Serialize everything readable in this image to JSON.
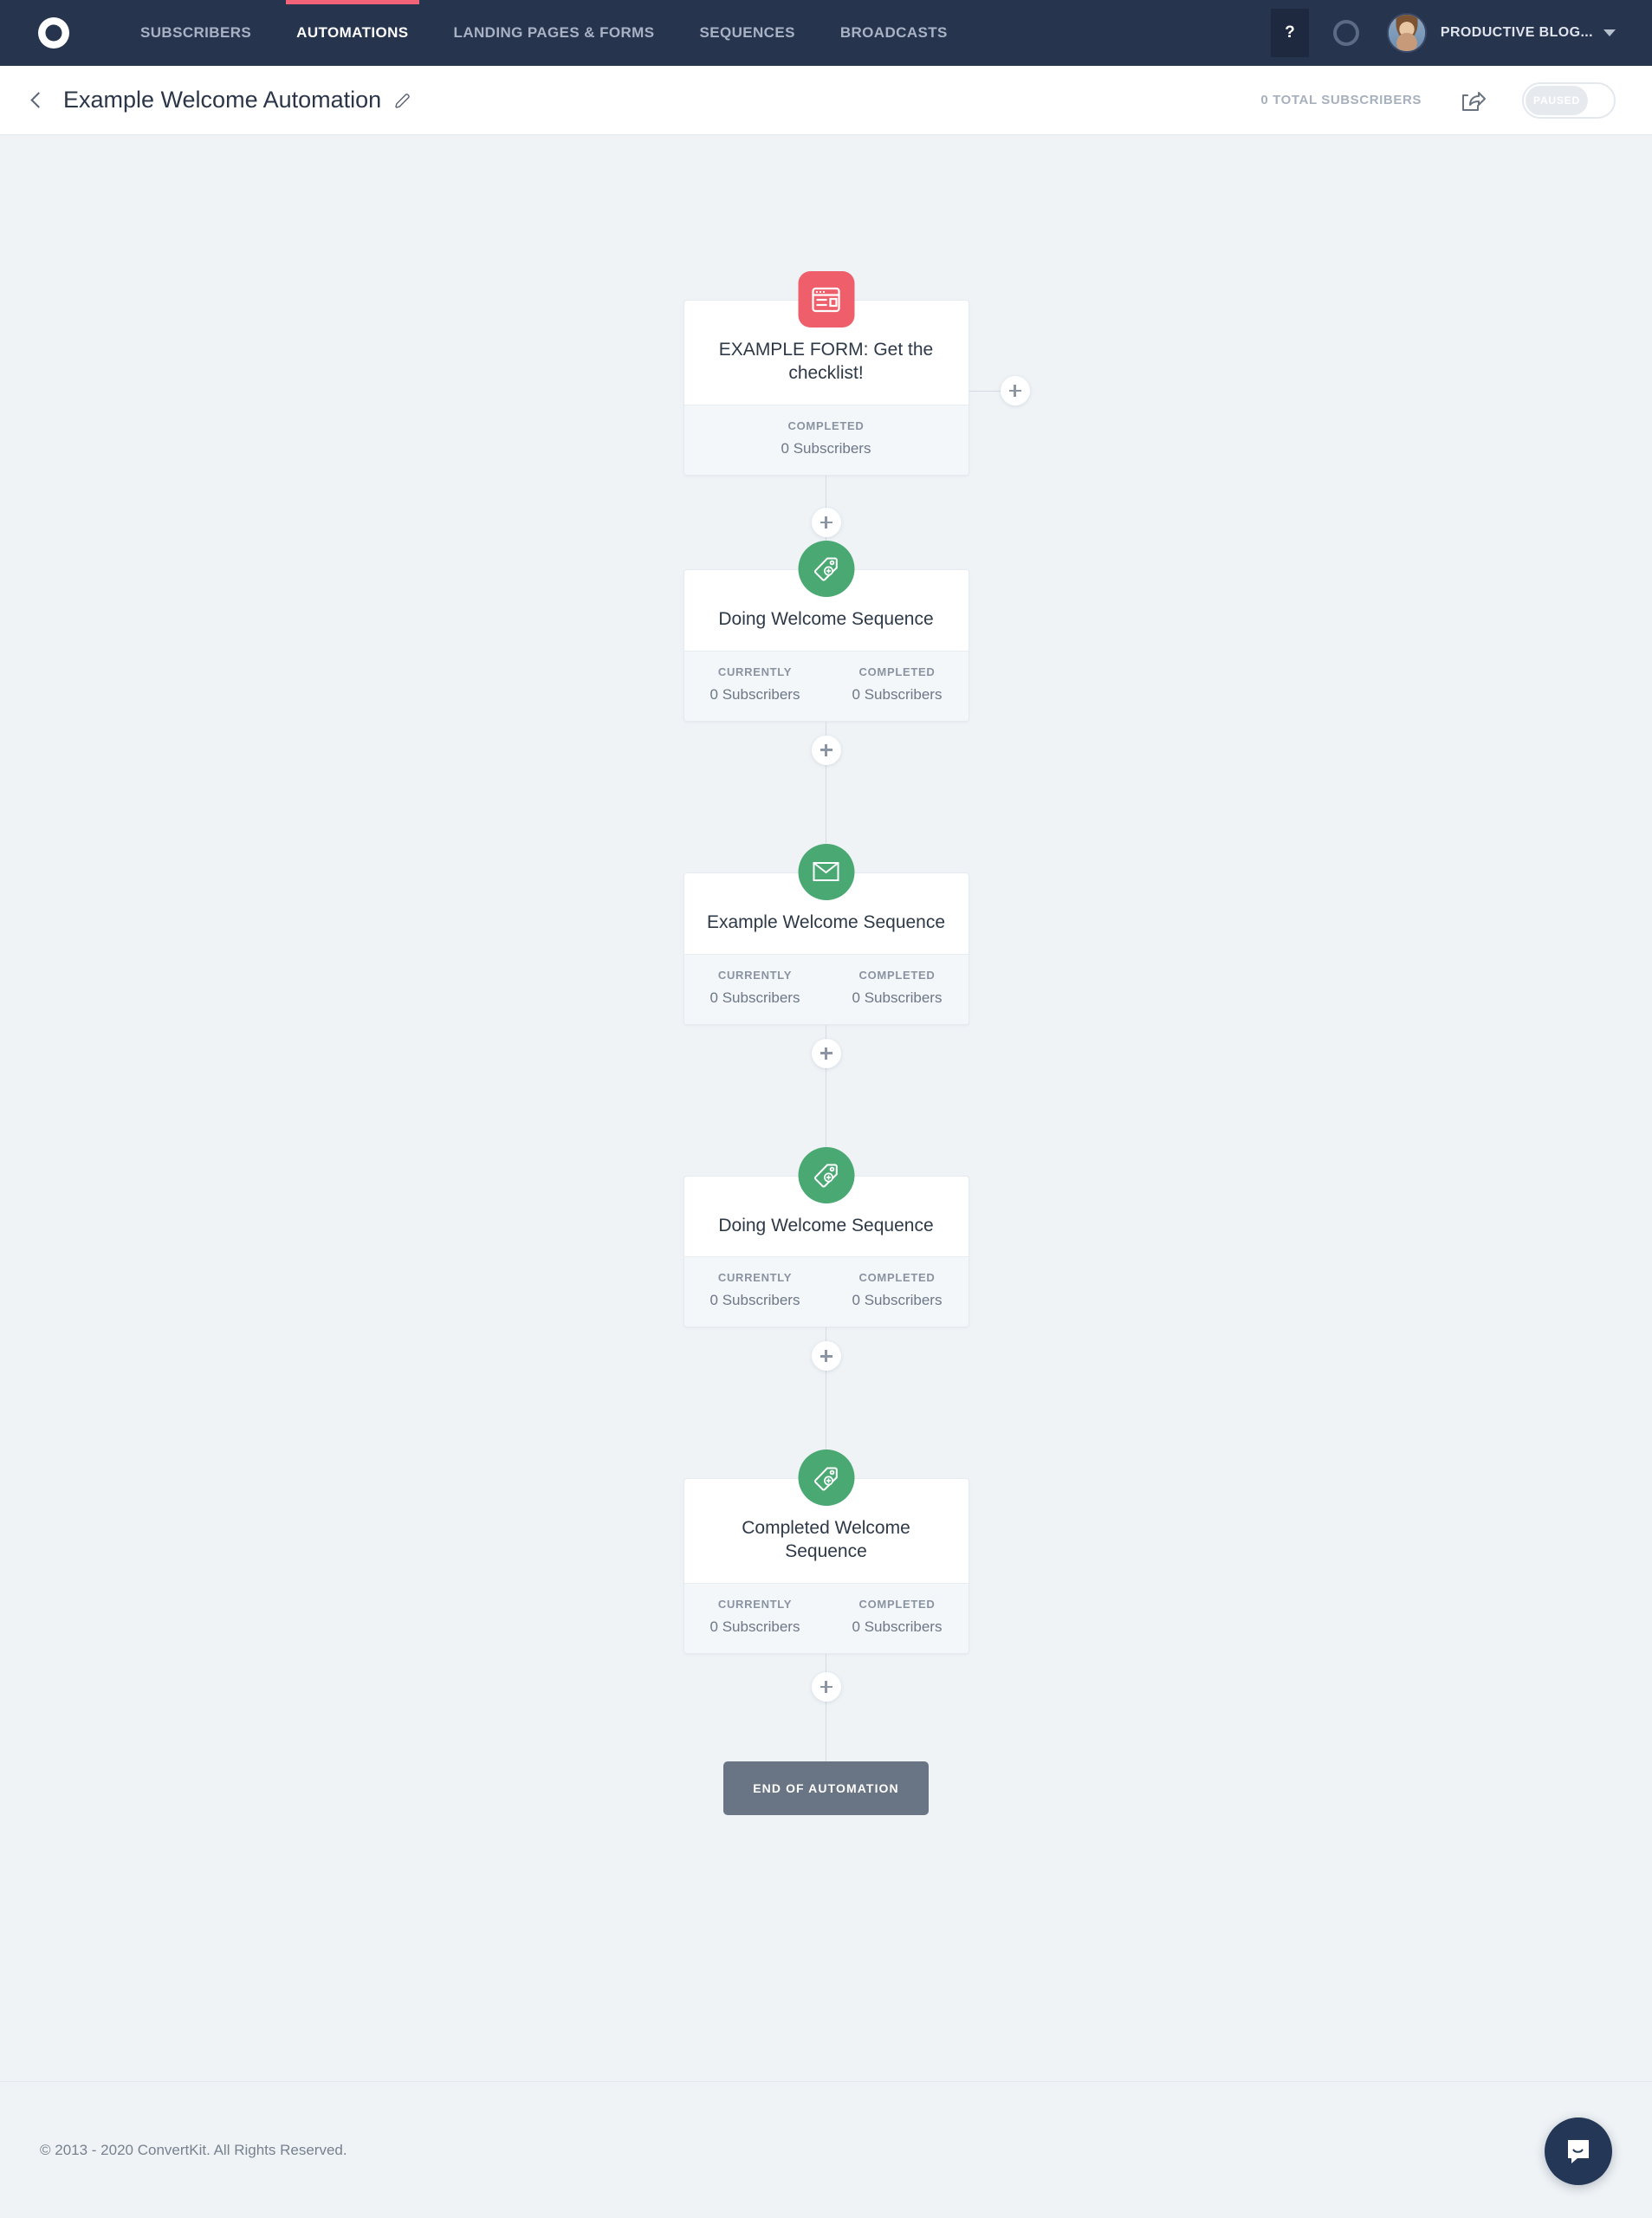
{
  "topnav": {
    "logo_icon": "convertkit-logo",
    "items": [
      {
        "label": "SUBSCRIBERS",
        "active": false
      },
      {
        "label": "AUTOMATIONS",
        "active": true
      },
      {
        "label": "LANDING PAGES & FORMS",
        "active": false
      },
      {
        "label": "SEQUENCES",
        "active": false
      },
      {
        "label": "BROADCASTS",
        "active": false
      }
    ],
    "help_label": "?",
    "status_icon": "circle-ring-icon",
    "avatar_icon": "user-avatar",
    "account_name": "PRODUCTIVE BLOG...",
    "caret_icon": "chevron-down-icon",
    "active_underline_color": "#f2637a",
    "background_color": "#27344e"
  },
  "subheader": {
    "back_icon": "back-chevron-icon",
    "title": "Example Welcome Automation",
    "edit_icon": "pencil-icon",
    "total_subscribers": "0 TOTAL SUBSCRIBERS",
    "share_icon": "share-icon",
    "toggle_label": "PAUSED",
    "toggle_state": "off"
  },
  "flow": {
    "nodes": [
      {
        "icon": "form-icon",
        "icon_type": "form",
        "icon_color": "#ef5f6b",
        "title": "EXAMPLE FORM: Get the checklist!",
        "stats": [
          {
            "label": "COMPLETED",
            "value": "0 Subscribers"
          }
        ],
        "has_side_branch": true
      },
      {
        "icon": "tag-icon",
        "icon_type": "tag",
        "icon_color": "#4aa873",
        "title": "Doing Welcome Sequence",
        "stats": [
          {
            "label": "CURRENTLY",
            "value": "0 Subscribers"
          },
          {
            "label": "COMPLETED",
            "value": "0 Subscribers"
          }
        ],
        "has_side_branch": false
      },
      {
        "icon": "email-icon",
        "icon_type": "email",
        "icon_color": "#4aa873",
        "title": "Example Welcome Sequence",
        "stats": [
          {
            "label": "CURRENTLY",
            "value": "0 Subscribers"
          },
          {
            "label": "COMPLETED",
            "value": "0 Subscribers"
          }
        ],
        "has_side_branch": false
      },
      {
        "icon": "tag-icon",
        "icon_type": "tag",
        "icon_color": "#4aa873",
        "title": "Doing Welcome Sequence",
        "stats": [
          {
            "label": "CURRENTLY",
            "value": "0 Subscribers"
          },
          {
            "label": "COMPLETED",
            "value": "0 Subscribers"
          }
        ],
        "has_side_branch": false
      },
      {
        "icon": "tag-icon",
        "icon_type": "tag",
        "icon_color": "#4aa873",
        "title": "Completed Welcome Sequence",
        "stats": [
          {
            "label": "CURRENTLY",
            "value": "0 Subscribers"
          },
          {
            "label": "COMPLETED",
            "value": "0 Subscribers"
          }
        ],
        "has_side_branch": false
      }
    ],
    "add_step_icon": "plus-icon",
    "end_label": "END OF AUTOMATION"
  },
  "footer": {
    "copyright": "© 2013 - 2020 ConvertKit. All Rights Reserved.",
    "chat_icon": "intercom-chat-icon"
  }
}
